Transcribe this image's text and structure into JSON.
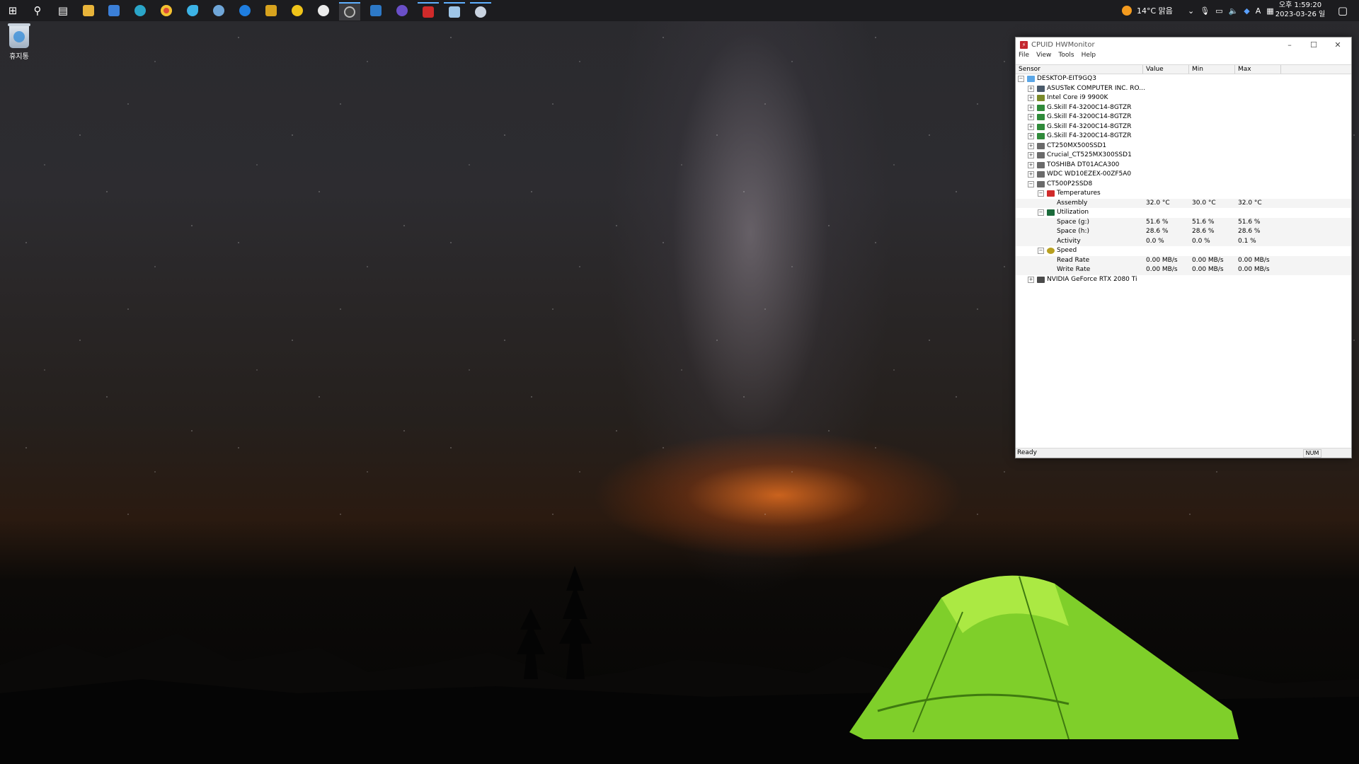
{
  "desktop": {
    "recycle_bin_label": "휴지통"
  },
  "tray": {
    "weather": "14°C 맑음",
    "ime": "A",
    "time": "오후 1:59:20",
    "date": "2023-03-26 일"
  },
  "hwmonitor": {
    "title": "CPUID HWMonitor",
    "menu": [
      "File",
      "View",
      "Tools",
      "Help"
    ],
    "columns": [
      "Sensor",
      "Value",
      "Min",
      "Max"
    ],
    "status": "Ready",
    "num_indicator": "NUM",
    "tree": [
      {
        "label": "DESKTOP-EIT9GQ3",
        "exp": "−",
        "icon": "computer",
        "value": "",
        "min": "",
        "max": ""
      },
      {
        "label": "ASUSTeK COMPUTER INC. RO...",
        "exp": "+",
        "icon": "motherboard",
        "value": "",
        "min": "",
        "max": ""
      },
      {
        "label": "Intel Core i9 9900K",
        "exp": "+",
        "icon": "cpu",
        "value": "",
        "min": "",
        "max": ""
      },
      {
        "label": "G.Skill F4-3200C14-8GTZR",
        "exp": "+",
        "icon": "memory",
        "value": "",
        "min": "",
        "max": ""
      },
      {
        "label": "G.Skill F4-3200C14-8GTZR",
        "exp": "+",
        "icon": "memory",
        "value": "",
        "min": "",
        "max": ""
      },
      {
        "label": "G.Skill F4-3200C14-8GTZR",
        "exp": "+",
        "icon": "memory",
        "value": "",
        "min": "",
        "max": ""
      },
      {
        "label": "G.Skill F4-3200C14-8GTZR",
        "exp": "+",
        "icon": "memory",
        "value": "",
        "min": "",
        "max": ""
      },
      {
        "label": "CT250MX500SSD1",
        "exp": "+",
        "icon": "drive",
        "value": "",
        "min": "",
        "max": ""
      },
      {
        "label": "Crucial_CT525MX300SSD1",
        "exp": "+",
        "icon": "drive",
        "value": "",
        "min": "",
        "max": ""
      },
      {
        "label": "TOSHIBA DT01ACA300",
        "exp": "+",
        "icon": "drive",
        "value": "",
        "min": "",
        "max": ""
      },
      {
        "label": "WDC WD10EZEX-00ZF5A0",
        "exp": "+",
        "icon": "drive",
        "value": "",
        "min": "",
        "max": ""
      },
      {
        "label": "CT500P2SSD8",
        "exp": "−",
        "icon": "drive",
        "value": "",
        "min": "",
        "max": ""
      },
      {
        "label": "Temperatures",
        "exp": "−",
        "icon": "thermometer",
        "value": "",
        "min": "",
        "max": ""
      },
      {
        "label": "Assembly",
        "exp": "",
        "icon": "",
        "value": "32.0 °C",
        "min": "30.0 °C",
        "max": "32.0 °C"
      },
      {
        "label": "Utilization",
        "exp": "−",
        "icon": "utilization",
        "value": "",
        "min": "",
        "max": ""
      },
      {
        "label": "Space (g:)",
        "exp": "",
        "icon": "",
        "value": "51.6 %",
        "min": "51.6 %",
        "max": "51.6 %"
      },
      {
        "label": "Space (h:)",
        "exp": "",
        "icon": "",
        "value": "28.6 %",
        "min": "28.6 %",
        "max": "28.6 %"
      },
      {
        "label": "Activity",
        "exp": "",
        "icon": "",
        "value": "0.0 %",
        "min": "0.0 %",
        "max": "0.1 %"
      },
      {
        "label": "Speed",
        "exp": "−",
        "icon": "speed",
        "value": "",
        "min": "",
        "max": ""
      },
      {
        "label": "Read Rate",
        "exp": "",
        "icon": "",
        "value": "0.00 MB/s",
        "min": "0.00 MB/s",
        "max": "0.00 MB/s"
      },
      {
        "label": "Write Rate",
        "exp": "",
        "icon": "",
        "value": "0.00 MB/s",
        "min": "0.00 MB/s",
        "max": "0.00 MB/s"
      },
      {
        "label": "NVIDIA GeForce RTX 2080 Ti",
        "exp": "+",
        "icon": "gpu",
        "value": "",
        "min": "",
        "max": ""
      }
    ]
  }
}
